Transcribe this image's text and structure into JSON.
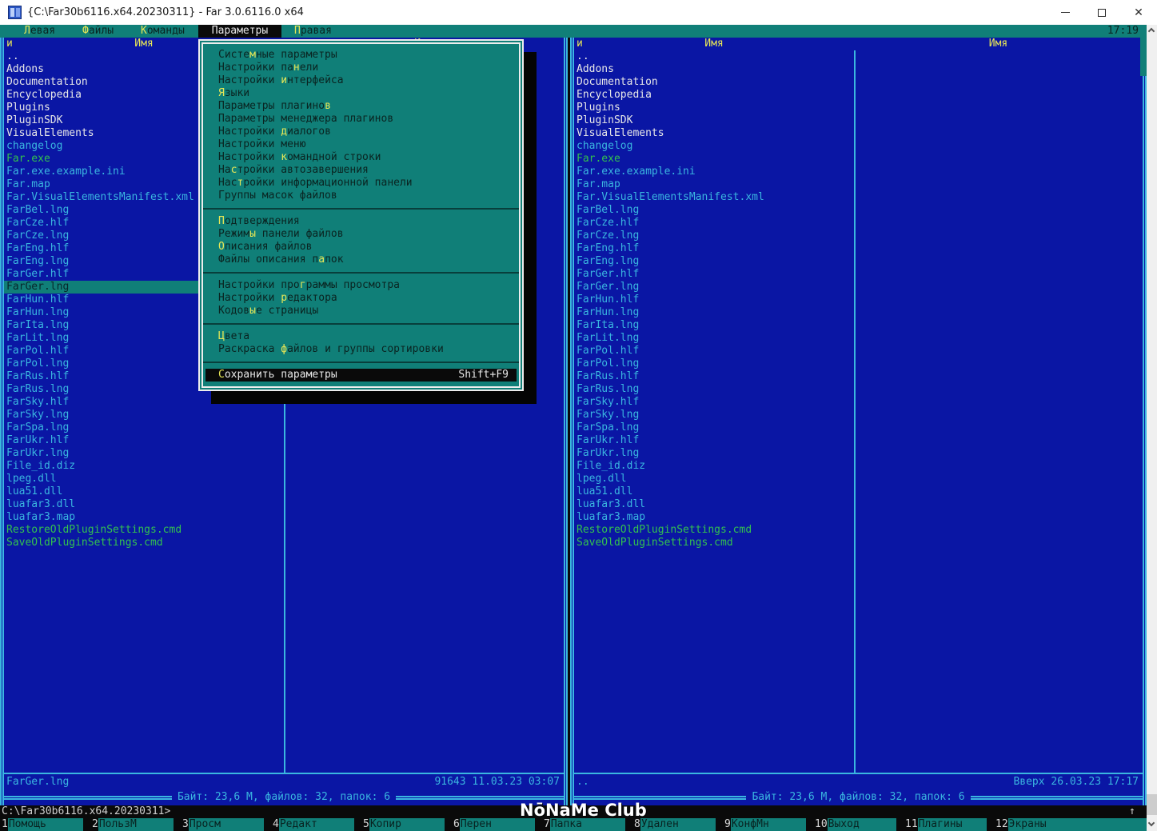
{
  "window": {
    "title": "{C:\\Far30b6116.x64.20230311} - Far 3.0.6116.0 x64"
  },
  "menubar": {
    "clock": "17:19",
    "items": [
      {
        "hot": "Л",
        "rest": "евая",
        "label": "Левая"
      },
      {
        "hot": "Ф",
        "rest": "айлы",
        "label": "Файлы"
      },
      {
        "hot": "К",
        "rest": "оманды",
        "label": "Команды"
      },
      {
        "label": "Параметры",
        "selected": true
      },
      {
        "hot": "П",
        "rest": "равая",
        "label": "Правая"
      }
    ]
  },
  "dropdown": {
    "items": [
      {
        "pre": "Систе",
        "hot": "м",
        "post": "ные параметры"
      },
      {
        "pre": "Настройки па",
        "hot": "н",
        "post": "ели"
      },
      {
        "pre": "Настройки ",
        "hot": "и",
        "post": "нтерфейса"
      },
      {
        "pre": "",
        "hot": "Я",
        "post": "зыки"
      },
      {
        "pre": "Параметры плагино",
        "hot": "в",
        "post": ""
      },
      {
        "pre": "Параметры менеджера плагинов",
        "hot": "",
        "post": ""
      },
      {
        "pre": "Настройки ",
        "hot": "д",
        "post": "иалогов"
      },
      {
        "pre": "Настройки меню",
        "hot": "",
        "post": ""
      },
      {
        "pre": "Настройки ",
        "hot": "к",
        "post": "омандной строки"
      },
      {
        "pre": "На",
        "hot": "с",
        "post": "тройки автозавершения"
      },
      {
        "pre": "Нас",
        "hot": "т",
        "post": "ройки информационной панели"
      },
      {
        "pre": "Группы масок файлов",
        "hot": "",
        "post": ""
      },
      {
        "separator": true
      },
      {
        "pre": "",
        "hot": "П",
        "post": "одтверждения"
      },
      {
        "pre": "Режим",
        "hot": "ы",
        "post": " панели файлов"
      },
      {
        "pre": "",
        "hot": "О",
        "post": "писания файлов"
      },
      {
        "pre": "Файлы описания п",
        "hot": "а",
        "post": "пок"
      },
      {
        "separator": true
      },
      {
        "pre": "Настройки про",
        "hot": "г",
        "post": "раммы просмотра"
      },
      {
        "pre": "Настройки ",
        "hot": "р",
        "post": "едактора"
      },
      {
        "pre": "Кодов",
        "hot": "ы",
        "post": "е страницы"
      },
      {
        "separator": true
      },
      {
        "pre": "",
        "hot": "Ц",
        "post": "вета"
      },
      {
        "pre": "Раскраска ",
        "hot": "ф",
        "post": "айлов и группы сортировки"
      },
      {
        "separator": true
      },
      {
        "pre": "",
        "hot": "С",
        "post": "охранить параметры",
        "shortcut": "Shift+F9",
        "selected": true
      }
    ]
  },
  "panels": {
    "sort_indicator": "и",
    "column_header": "Имя",
    "files": [
      {
        "name": "..",
        "type": "dir"
      },
      {
        "name": "Addons",
        "type": "dir"
      },
      {
        "name": "Documentation",
        "type": "dir"
      },
      {
        "name": "Encyclopedia",
        "type": "dir"
      },
      {
        "name": "Plugins",
        "type": "dir"
      },
      {
        "name": "PluginSDK",
        "type": "dir"
      },
      {
        "name": "VisualElements",
        "type": "dir"
      },
      {
        "name": "changelog",
        "type": "file"
      },
      {
        "name": "Far.exe",
        "type": "exe"
      },
      {
        "name": "Far.exe.example.ini",
        "type": "file"
      },
      {
        "name": "Far.map",
        "type": "file"
      },
      {
        "name": "Far.VisualElementsManifest.xml",
        "type": "file"
      },
      {
        "name": "FarBel.lng",
        "type": "file"
      },
      {
        "name": "FarCze.hlf",
        "type": "file"
      },
      {
        "name": "FarCze.lng",
        "type": "file"
      },
      {
        "name": "FarEng.hlf",
        "type": "file"
      },
      {
        "name": "FarEng.lng",
        "type": "file"
      },
      {
        "name": "FarGer.hlf",
        "type": "file"
      },
      {
        "name": "FarGer.lng",
        "type": "file"
      },
      {
        "name": "FarHun.hlf",
        "type": "file"
      },
      {
        "name": "FarHun.lng",
        "type": "file"
      },
      {
        "name": "FarIta.lng",
        "type": "file"
      },
      {
        "name": "FarLit.lng",
        "type": "file"
      },
      {
        "name": "FarPol.hlf",
        "type": "file"
      },
      {
        "name": "FarPol.lng",
        "type": "file"
      },
      {
        "name": "FarRus.hlf",
        "type": "file"
      },
      {
        "name": "FarRus.lng",
        "type": "file"
      },
      {
        "name": "FarSky.hlf",
        "type": "file"
      },
      {
        "name": "FarSky.lng",
        "type": "file"
      },
      {
        "name": "FarSpa.lng",
        "type": "file"
      },
      {
        "name": "FarUkr.hlf",
        "type": "file"
      },
      {
        "name": "FarUkr.lng",
        "type": "file"
      },
      {
        "name": "File_id.diz",
        "type": "file"
      },
      {
        "name": "lpeg.dll",
        "type": "file"
      },
      {
        "name": "lua51.dll",
        "type": "file"
      },
      {
        "name": "luafar3.dll",
        "type": "file"
      },
      {
        "name": "luafar3.map",
        "type": "file"
      },
      {
        "name": "RestoreOldPluginSettings.cmd",
        "type": "exe"
      },
      {
        "name": "SaveOldPluginSettings.cmd",
        "type": "exe"
      }
    ],
    "left": {
      "cursor": "FarGer.lng",
      "status_name": "FarGer.lng",
      "status_info": "91643 11.03.23 03:07",
      "totals": "Байт: 23,6 M, файлов: 32, папок: 6"
    },
    "right": {
      "cursor": "",
      "status_name": "..",
      "status_info": "Вверх 26.03.23 17:17",
      "totals": "Байт: 23,6 M, файлов: 32, папок: 6"
    }
  },
  "command_line": {
    "prompt": "C:\\Far30b6116.x64.20230311>",
    "history_arrow": "↑"
  },
  "fkeys": [
    {
      "num": "1",
      "label": "Помощь"
    },
    {
      "num": "2",
      "label": "ПользМ"
    },
    {
      "num": "3",
      "label": "Просм"
    },
    {
      "num": "4",
      "label": "Редакт"
    },
    {
      "num": "5",
      "label": "Копир"
    },
    {
      "num": "6",
      "label": "Перен"
    },
    {
      "num": "7",
      "label": "Папка"
    },
    {
      "num": "8",
      "label": "Удален"
    },
    {
      "num": "9",
      "label": "КонфМн"
    },
    {
      "num": "10",
      "label": "Выход"
    },
    {
      "num": "11",
      "label": "Плагины"
    },
    {
      "num": "12",
      "label": "Экраны"
    }
  ],
  "watermark": "NōNaMe Club"
}
